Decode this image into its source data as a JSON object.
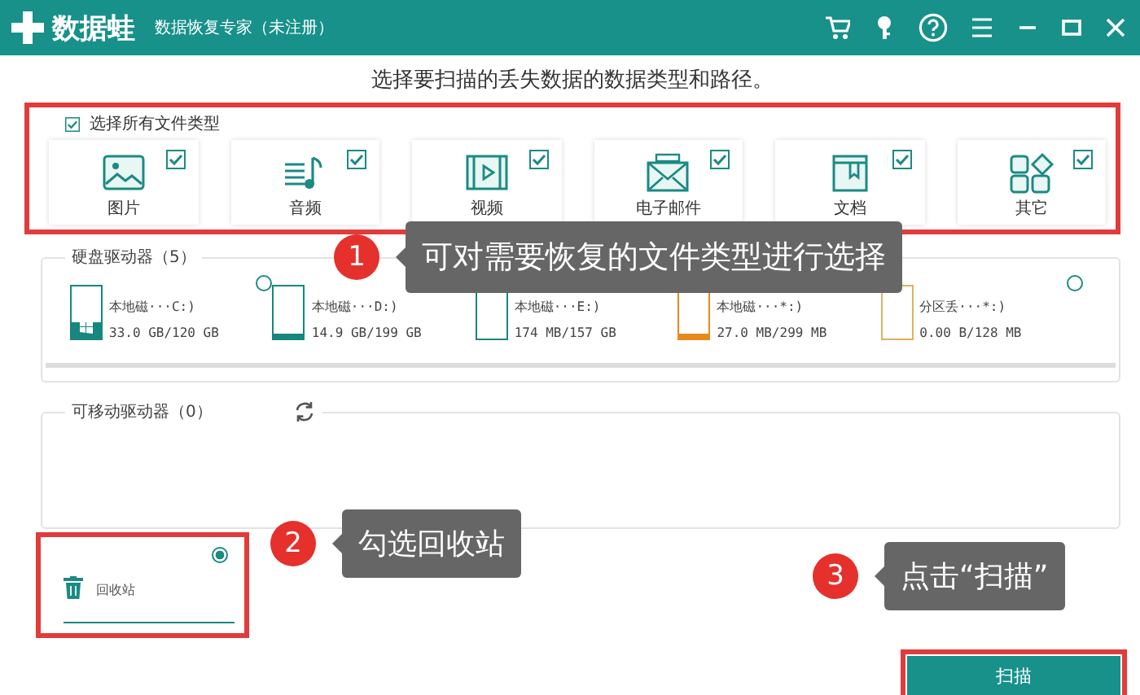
{
  "window": {
    "app_name": "数据蛙",
    "title": "数据恢复专家（未注册）"
  },
  "heading": "选择要扫描的丢失数据的数据类型和路径。",
  "select_all": {
    "label": "选择所有文件类型",
    "checked": true
  },
  "file_types": [
    {
      "kind": "image",
      "label": "图片",
      "checked": true
    },
    {
      "kind": "audio",
      "label": "音频",
      "checked": true
    },
    {
      "kind": "video",
      "label": "视频",
      "checked": true
    },
    {
      "kind": "email",
      "label": "电子邮件",
      "checked": true
    },
    {
      "kind": "document",
      "label": "文档",
      "checked": true
    },
    {
      "kind": "other",
      "label": "其它",
      "checked": true
    }
  ],
  "hard_drives": {
    "title": "硬盘驱动器（5）",
    "drives": [
      {
        "name": "本地磁···C:)",
        "usage": "33.0 GB/120 GB",
        "level": 0.3,
        "color": "#16867f",
        "system": true,
        "selected": false
      },
      {
        "name": "本地磁···D:)",
        "usage": "14.9 GB/199 GB",
        "level": 0.1,
        "color": "#16867f",
        "system": false
      },
      {
        "name": "本地磁···E:)",
        "usage": "174 MB/157 GB",
        "level": 0,
        "color": "#16867f",
        "system": false
      },
      {
        "name": "本地磁···*:)",
        "usage": "27.0 MB/299 MB",
        "level": 0.1,
        "color": "#e8891c",
        "system": false
      },
      {
        "name": "分区丢···*:)",
        "usage": "0.00  B/128 MB",
        "level": 0,
        "color": "#e0b063",
        "system": false,
        "selected": false
      }
    ]
  },
  "removable_drives": {
    "title": "可移动驱动器（0）"
  },
  "recycle_bin": {
    "label": "回收站",
    "selected": true
  },
  "scan_button": "扫描",
  "callouts": [
    {
      "number": "1",
      "text": "可对需要恢复的文件类型进行选择"
    },
    {
      "number": "2",
      "text": "勾选回收站"
    },
    {
      "number": "3",
      "text": "点击“扫描”"
    }
  ]
}
